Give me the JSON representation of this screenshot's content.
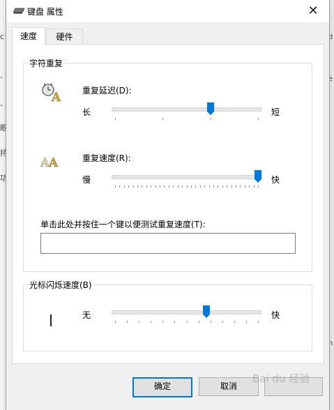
{
  "window": {
    "title": "键盘 属性"
  },
  "tabs": [
    {
      "label": "速度",
      "active": true
    },
    {
      "label": "硬件",
      "active": false
    }
  ],
  "repeat_group": {
    "legend": "字符重复",
    "delay": {
      "label": "重复延迟(D):",
      "min_label": "长",
      "max_label": "短",
      "value_fraction": 0.67,
      "ticks": 4
    },
    "rate": {
      "label": "重复速度(R):",
      "min_label": "慢",
      "max_label": "快",
      "value_fraction": 1.0,
      "ticks": 33
    },
    "test_label": "单击此处并按住一个键以便测试重复速度(T):",
    "test_value": ""
  },
  "cursor_group": {
    "legend": "光标闪烁速度(B)",
    "min_label": "无",
    "max_label": "快",
    "value_fraction": 0.64,
    "ticks": 13
  },
  "buttons": {
    "ok": "确定",
    "cancel": "取消"
  },
  "background": {
    "left_chars": [
      "c",
      "-",
      "-",
      "眼",
      "持",
      "功"
    ],
    "right_chars": [
      "d",
      "e",
      "n"
    ]
  },
  "watermark": "Bai du 经验",
  "colors": {
    "accent": "#0078d7",
    "slider_thumb": "#0078d7"
  }
}
